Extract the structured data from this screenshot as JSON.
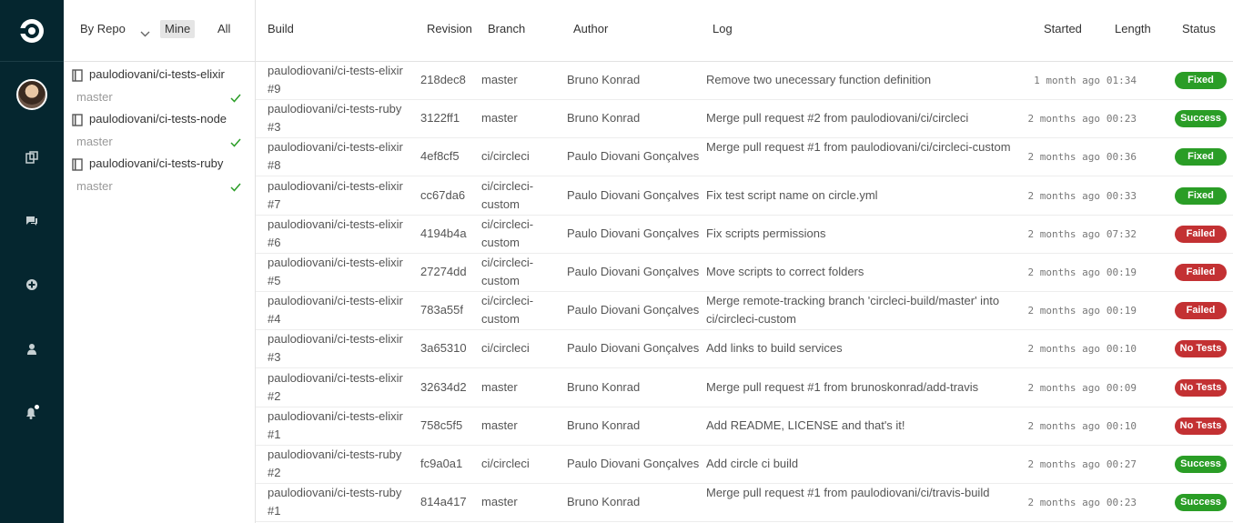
{
  "colors": {
    "rail_bg": "#05262f",
    "success": "#2a9d26",
    "failed": "#c33133"
  },
  "nav": {
    "items": [
      {
        "icon": "circleci-logo-icon"
      },
      {
        "icon": "user-avatar"
      },
      {
        "icon": "builds-icon"
      },
      {
        "icon": "chat-icon"
      },
      {
        "icon": "add-project-icon"
      },
      {
        "icon": "account-icon"
      },
      {
        "icon": "notifications-icon"
      }
    ]
  },
  "sidebar": {
    "filter_by": "By Repo",
    "mine_label": "Mine",
    "all_label": "All",
    "repos": [
      {
        "name": "paulodiovani/ci-tests-elixir",
        "branch": "master"
      },
      {
        "name": "paulodiovani/ci-tests-node",
        "branch": "master"
      },
      {
        "name": "paulodiovani/ci-tests-ruby",
        "branch": "master"
      }
    ]
  },
  "table": {
    "headers": {
      "build": "Build",
      "revision": "Revision",
      "branch": "Branch",
      "author": "Author",
      "log": "Log",
      "started": "Started",
      "length": "Length",
      "status": "Status"
    },
    "rows": [
      {
        "repo": "paulodiovani/ci-tests-elixir",
        "num": "#9",
        "revision": "218dec8",
        "branch": "master",
        "author": "Bruno Konrad",
        "log": "Remove two unecessary function definition",
        "started": "1 month ago",
        "length": "01:34",
        "status": "Fixed"
      },
      {
        "repo": "paulodiovani/ci-tests-ruby",
        "num": "#3",
        "revision": "3122ff1",
        "branch": "master",
        "author": "Bruno Konrad",
        "log": "Merge pull request #2 from paulodiovani/ci/circleci",
        "started": "2 months ago",
        "length": "00:23",
        "status": "Success"
      },
      {
        "repo": "paulodiovani/ci-tests-elixir",
        "num": "#8",
        "revision": "4ef8cf5",
        "branch": "ci/circleci",
        "author": "Paulo Diovani Gonçalves",
        "log": "Merge pull request #1 from paulodiovani/ci/circleci-custom",
        "started": "2 months ago",
        "length": "00:36",
        "status": "Fixed"
      },
      {
        "repo": "paulodiovani/ci-tests-elixir",
        "num": "#7",
        "revision": "cc67da6",
        "branch": "ci/circleci-custom",
        "author": "Paulo Diovani Gonçalves",
        "log": "Fix test script name on circle.yml",
        "started": "2 months ago",
        "length": "00:33",
        "status": "Fixed"
      },
      {
        "repo": "paulodiovani/ci-tests-elixir",
        "num": "#6",
        "revision": "4194b4a",
        "branch": "ci/circleci-custom",
        "author": "Paulo Diovani Gonçalves",
        "log": "Fix scripts permissions",
        "started": "2 months ago",
        "length": "07:32",
        "status": "Failed"
      },
      {
        "repo": "paulodiovani/ci-tests-elixir",
        "num": "#5",
        "revision": "27274dd",
        "branch": "ci/circleci-custom",
        "author": "Paulo Diovani Gonçalves",
        "log": "Move scripts to correct folders",
        "started": "2 months ago",
        "length": "00:19",
        "status": "Failed"
      },
      {
        "repo": "paulodiovani/ci-tests-elixir",
        "num": "#4",
        "revision": "783a55f",
        "branch": "ci/circleci-custom",
        "author": "Paulo Diovani Gonçalves",
        "log": "Merge remote-tracking branch 'circleci-build/master' into ci/circleci-custom",
        "started": "2 months ago",
        "length": "00:19",
        "status": "Failed"
      },
      {
        "repo": "paulodiovani/ci-tests-elixir",
        "num": "#3",
        "revision": "3a65310",
        "branch": "ci/circleci",
        "author": "Paulo Diovani Gonçalves",
        "log": "Add links to build services",
        "started": "2 months ago",
        "length": "00:10",
        "status": "No Tests"
      },
      {
        "repo": "paulodiovani/ci-tests-elixir",
        "num": "#2",
        "revision": "32634d2",
        "branch": "master",
        "author": "Bruno Konrad",
        "log": "Merge pull request #1 from brunoskonrad/add-travis",
        "started": "2 months ago",
        "length": "00:09",
        "status": "No Tests"
      },
      {
        "repo": "paulodiovani/ci-tests-elixir",
        "num": "#1",
        "revision": "758c5f5",
        "branch": "master",
        "author": "Bruno Konrad",
        "log": "Add README, LICENSE and that's it!",
        "started": "2 months ago",
        "length": "00:10",
        "status": "No Tests"
      },
      {
        "repo": "paulodiovani/ci-tests-ruby",
        "num": "#2",
        "revision": "fc9a0a1",
        "branch": "ci/circleci",
        "author": "Paulo Diovani Gonçalves",
        "log": "Add circle ci build",
        "started": "2 months ago",
        "length": "00:27",
        "status": "Success"
      },
      {
        "repo": "paulodiovani/ci-tests-ruby",
        "num": "#1",
        "revision": "814a417",
        "branch": "master",
        "author": "Bruno Konrad",
        "log": "Merge pull request #1 from paulodiovani/ci/travis-build",
        "started": "2 months ago",
        "length": "00:23",
        "status": "Success"
      }
    ]
  }
}
